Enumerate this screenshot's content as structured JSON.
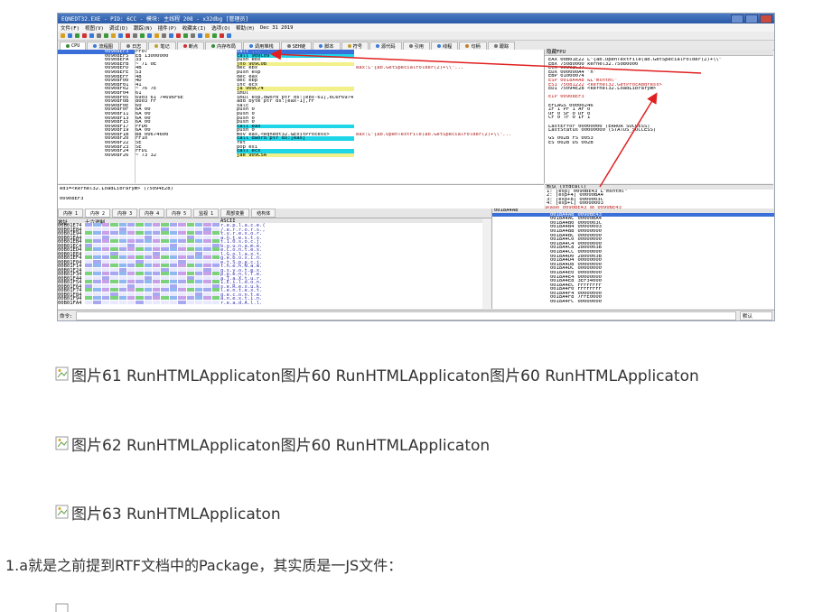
{
  "screenshot": {
    "title": "EQNEDT32.EXE - PID: 6CC - 模块: 主线程 208 - x32dbg [管理员]",
    "menu": [
      "文件(F)",
      "视图(V)",
      "调试(D)",
      "跟踪(N)",
      "插件(P)",
      "收藏夹(I)",
      "选项(O)",
      "帮助(H)",
      "Dec 31 2019"
    ],
    "tabs": [
      {
        "label": "CPU",
        "color": "#3a8a3a"
      },
      {
        "label": "流程图",
        "color": "#3a7ad8"
      },
      {
        "label": "日志",
        "color": "#777777"
      },
      {
        "label": "笔记",
        "color": "#c0a030"
      },
      {
        "label": "断点",
        "color": "#d03030"
      },
      {
        "label": "内存布局",
        "color": "#3a8a3a"
      },
      {
        "label": "调用堆栈",
        "color": "#3a7ad8"
      },
      {
        "label": "SEH链",
        "color": "#777777"
      },
      {
        "label": "脚本",
        "color": "#3a7ad8"
      },
      {
        "label": "符号",
        "color": "#c0a030"
      },
      {
        "label": "源代码",
        "color": "#3a7ad8"
      },
      {
        "label": "引用",
        "color": "#777777"
      },
      {
        "label": "线程",
        "color": "#3a7ad8"
      },
      {
        "label": "句柄",
        "color": "#c08030"
      },
      {
        "label": "跟踪",
        "color": "#777777"
      }
    ],
    "cpu_rows": [
      {
        "addr": "00908EF3",
        "bytes": "FF07",
        "asm": "call ...",
        "cls": "sel",
        "cmt": ""
      },
      {
        "addr": "00908EF5",
        "bytes": "E8 13000000",
        "asm": "call 909C09",
        "cls": "call",
        "cmt": ""
      },
      {
        "addr": "00908EFA",
        "bytes": "33",
        "asm": "push ebx",
        "cls": "",
        "cmt": ""
      },
      {
        "addr": "00908EFB",
        "bytes": "~ 71 0E",
        "asm": "jno 909C0B",
        "cls": "jmp",
        "cmt": ""
      },
      {
        "addr": "00908EFD",
        "bytes": "4B",
        "asm": "dec ebx",
        "cls": "",
        "cmt": "eax:L\"{ab.GetSpecialFolder(2)+\\\\\"..."
      },
      {
        "addr": "00908EFE",
        "bytes": "53",
        "asm": "push esp",
        "cls": "",
        "cmt": ""
      },
      {
        "addr": "00908EFF",
        "bytes": "48",
        "asm": "dec eax",
        "cls": "",
        "cmt": ""
      },
      {
        "addr": "00908F00",
        "bytes": "4D",
        "asm": "dec ebp",
        "cls": "",
        "cmt": ""
      },
      {
        "addr": "00908F01",
        "bytes": "41",
        "asm": "inc ecx",
        "cls": "",
        "cmt": ""
      },
      {
        "addr": "00908F02",
        "bytes": "~ 76 7E",
        "asm": "ja 909C74",
        "cls": "jmp",
        "cmt": ""
      },
      {
        "addr": "00908F04",
        "bytes": "61",
        "asm": "imul",
        "cls": "",
        "cmt": ""
      },
      {
        "addr": "00908F05",
        "bytes": "6903 61 74696F6E",
        "asm": "imul esp,dword ptr ds:[ebx-61],6C6F6974",
        "cls": "",
        "cmt": ""
      },
      {
        "addr": "00908F0B",
        "bytes": "8003 FF",
        "asm": "add byte ptr ds:[eax-1],FF",
        "cls": "",
        "cmt": ""
      },
      {
        "addr": "00908F0E",
        "bytes": "60",
        "asm": "salc",
        "cls": "",
        "cmt": ""
      },
      {
        "addr": "00908F0F",
        "bytes": "6A 00",
        "asm": "push 0",
        "cls": "",
        "cmt": ""
      },
      {
        "addr": "00908F11",
        "bytes": "6A 00",
        "asm": "push 0",
        "cls": "",
        "cmt": ""
      },
      {
        "addr": "00908F13",
        "bytes": "6A 00",
        "asm": "push 0",
        "cls": "",
        "cmt": ""
      },
      {
        "addr": "00908F15",
        "bytes": "6A 00",
        "asm": "push 0",
        "cls": "",
        "cmt": ""
      },
      {
        "addr": "00908F17",
        "bytes": "FFD0",
        "asm": "call eax",
        "cls": "call",
        "cmt": ""
      },
      {
        "addr": "00908F19",
        "bytes": "6A 00",
        "asm": "push 0",
        "cls": "",
        "cmt": ""
      },
      {
        "addr": "00908F1B",
        "bytes": "B8 00674600",
        "asm": "mov eax,<eqnedt32.&ExitProcess>",
        "cls": "",
        "cmt": "eax:L\"{ab.OpenTextFile(ab.GetSpecialFolder(2)+\\\\\"..."
      },
      {
        "addr": "00908F20",
        "bytes": "FF10",
        "asm": "call dword ptr ds:[eax]",
        "cls": "call",
        "cmt": ""
      },
      {
        "addr": "00908F22",
        "bytes": "5E",
        "asm": "ret",
        "cls": "",
        "cmt": ""
      },
      {
        "addr": "00908F23",
        "bytes": "5E",
        "asm": "pop esi",
        "cls": "",
        "cmt": ""
      },
      {
        "addr": "00908F24",
        "bytes": "FFD1",
        "asm": "call ecx",
        "cls": "call",
        "cmt": ""
      },
      {
        "addr": "00908F26",
        "bytes": "~ 73 32",
        "asm": "jae 909C5A",
        "cls": "jmp",
        "cmt": ""
      }
    ],
    "regs_header": "隐藏FPU",
    "regs": [
      "EAX  00B01E22   L\"{ab.OpenTextFile(ab.GetSpecialFolder(2)+\\\\\"",
      "EBX  75080000   kernel32.75080000",
      "ECX  00903C27",
      "EDX  000000A4   'n'",
      "EBP  01000074",
      "ESP  0018A4A8   &L\"mshtml\"",
      "ESI  75081222   <kernel32.GetProcAddress>",
      "EDI  75094E28   <kernel32.LoadLibraryW>",
      "",
      "EIP  00908EF3",
      "",
      "EFLAGS  00000246",
      "ZF 1  PF 1  AF 0",
      "OF 0  SF 0  DF 0",
      "CF 0  TF 0  IF 1",
      "",
      "LastError  00000000 (ERROR_SUCCESS)",
      "LastStatus 00000000 (STATUS_SUCCESS)",
      "",
      "GS 002B  FS 0053",
      "ES 002B  DS 002B"
    ],
    "info_line1": "edi=<kernel32.LoadLibraryW> (75094E28)",
    "info_line2": "00908EF3",
    "stack_mini_header": "默认 (stdcall)",
    "stack_mini_rows": [
      "1: [esp] 0090BE43 L\"mshtml\"",
      "2: [esp+4] 00000BA4",
      "3: [esp+8] 0000003C",
      "4: [esp+C] 00000003"
    ],
    "stack_mini_sel": "返回到 0090BE43 自 0090BE43",
    "dump_tabs": [
      "内存 1",
      "内存 2",
      "内存 3",
      "内存 4",
      "内存 5",
      "监视 1",
      "局部变量",
      "结构体"
    ],
    "dump_headers": {
      "addr": "地址",
      "hex": "十六进制",
      "ascii": "ASCII"
    },
    "dump_addrs": [
      "00B01E74",
      "00B01E84",
      "00B01E94",
      "00B01EA4",
      "00B01EB4",
      "00B01EC4",
      "00B01ED4",
      "00B01EE4",
      "00B01EF4",
      "00B01F04",
      "00B01F14",
      "00B01F24",
      "00B01F34",
      "00B01F44",
      "00B01F54",
      "00B01F64",
      "00B01F74",
      "00B01F84",
      "00B01F94",
      "00B01FA4"
    ],
    "dump_ascii": [
      "r.e.p.l.a.c.e.(",
      "/.e.r.r.o.r.s.,",
      "t.y.r.e.x.o.r.",
      "a.n.t.e.s.t.s.",
      "t.1.0.s.o.c.j.",
      "b.o.u.n.a.m.e.",
      "e.C.o.n.t.e.x.",
      "l.G.o.l.a.x.t.",
      "g.e.b.o.x.i.n.",
      "e.t.S.p.e.c.i.",
      "t.h.e.n.N.a.m.",
      "g.s.y.o.t.e.x.",
      "p.p.e.n.t.T.e.",
      "a.T.a.X.t.u.r.",
      "1.E.i.l.d.o.n.",
      "s.e.R.e.x.u.k.",
      "l.e.n.t.e.x.t.",
      "g.e.c.o.n.t.e.",
      "a.n.e.x.t.i.n.",
      "r.e.a.d.A.l.l."
    ],
    "stack_header": "0018A4A8",
    "stack_rows": [
      [
        "0018A4A8",
        "0090BE43"
      ],
      [
        "0018A4AC",
        "00000BA4"
      ],
      [
        "0018A4B0",
        "0000003C"
      ],
      [
        "0018A4B4",
        "00000003"
      ],
      [
        "0018A4B8",
        "00000000"
      ],
      [
        "0018A4BC",
        "00000000"
      ],
      [
        "0018A4C0",
        "00000000"
      ],
      [
        "0018A4C4",
        "00000000"
      ],
      [
        "0018A4C8",
        "2800003B"
      ],
      [
        "0018A4CC",
        "00000000"
      ],
      [
        "0018A4D0",
        "2800003B"
      ],
      [
        "0018A4D4",
        "00000000"
      ],
      [
        "0018A4D8",
        "00000000"
      ],
      [
        "0018A4DC",
        "00000000"
      ],
      [
        "0018A4E0",
        "00000000"
      ],
      [
        "0018A4E4",
        "00000000"
      ],
      [
        "0018A4E8",
        "3EF34000"
      ],
      [
        "0018A4EC",
        "FFFFFFFF"
      ],
      [
        "0018A4F0",
        "FFFFFFFF"
      ],
      [
        "0018A4F4",
        "00000000"
      ],
      [
        "0018A4F8",
        "7FFE0000"
      ],
      [
        "0018A4FC",
        "00000000"
      ]
    ],
    "cmd_label": "命令:",
    "cmd_default": "默认"
  },
  "captions": [
    "图片61 RunHTMLApplicaton图片60 RunHTMLApplicaton图片60 RunHTMLApplicaton",
    "图片62 RunHTMLApplicaton图片60 RunHTMLApplicaton",
    "图片63 RunHTMLApplicaton"
  ],
  "paragraph": "1.a就是之前提到RTF文档中的Package，其实质是一JS文件："
}
